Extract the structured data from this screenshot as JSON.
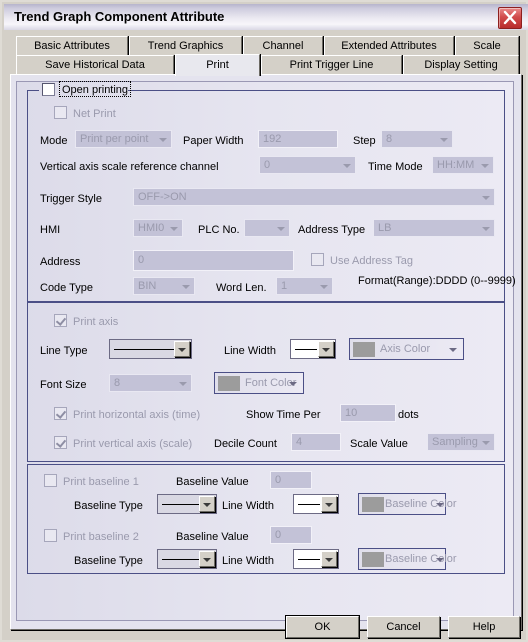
{
  "window": {
    "title": "Trend Graph Component Attribute",
    "close_label": "Close"
  },
  "tabs": {
    "row1": [
      {
        "label": "Basic Attributes",
        "active": false
      },
      {
        "label": "Trend Graphics",
        "active": false
      },
      {
        "label": "Channel",
        "active": false
      },
      {
        "label": "Extended Attributes",
        "active": false
      },
      {
        "label": "Scale",
        "active": false
      }
    ],
    "row2": [
      {
        "label": "Save Historical Data",
        "active": false
      },
      {
        "label": "Print",
        "active": true
      },
      {
        "label": "Print Trigger Line",
        "active": false
      },
      {
        "label": "Display Setting",
        "active": false
      }
    ]
  },
  "print_group": {
    "open_printing_label": "Open printing",
    "open_printing_checked": false,
    "net_print_label": "Net Print",
    "net_print_checked": false,
    "mode_label": "Mode",
    "mode_value": "Print per point",
    "paper_width_label": "Paper Width",
    "paper_width_value": "192",
    "step_label": "Step",
    "step_value": "8",
    "vertical_axis_label": "Vertical axis scale reference channel",
    "vertical_axis_value": "0",
    "time_mode_label": "Time Mode",
    "time_mode_value": "HH:MM",
    "trigger_style_label": "Trigger Style",
    "trigger_style_value": "OFF->ON",
    "hmi_label": "HMI",
    "hmi_value": "HMI0",
    "plc_no_label": "PLC No.",
    "plc_no_value": "",
    "address_type_label": "Address Type",
    "address_type_value": "LB",
    "address_label": "Address",
    "address_value": "0",
    "use_address_tag_label": "Use Address Tag",
    "use_address_tag_checked": false,
    "format_label": "Format(Range):DDDD (0--9999)",
    "code_type_label": "Code Type",
    "code_type_value": "BIN",
    "word_len_label": "Word Len.",
    "word_len_value": "1"
  },
  "axis_group": {
    "print_axis_label": "Print axis",
    "print_axis_checked": true,
    "line_type_label": "Line Type",
    "line_width_label": "Line Width",
    "axis_color_label": "Axis Color",
    "axis_color_swatch": "#9c9c9c",
    "font_size_label": "Font Size",
    "font_size_value": "8",
    "font_color_label": "Font Color",
    "font_color_swatch": "#9c9c9c",
    "print_horizontal_label": "Print horizontal axis (time)",
    "print_horizontal_checked": true,
    "show_time_per_label": "Show Time Per",
    "show_time_per_value": "10",
    "dots_label": "dots",
    "print_vertical_label": "Print vertical axis (scale)",
    "print_vertical_checked": true,
    "decile_count_label": "Decile Count",
    "decile_count_value": "4",
    "scale_value_label": "Scale Value",
    "scale_value_value": "Sampling"
  },
  "baseline_group": {
    "rows": [
      {
        "print_label": "Print baseline 1",
        "print_checked": false,
        "value_label": "Baseline Value",
        "value": "0",
        "type_label": "Baseline Type",
        "width_label": "Line Width",
        "color_label": "Baseline Color",
        "color_swatch": "#9c9c9c"
      },
      {
        "print_label": "Print baseline 2",
        "print_checked": false,
        "value_label": "Baseline Value",
        "value": "0",
        "type_label": "Baseline Type",
        "width_label": "Line Width",
        "color_label": "Baseline Color",
        "color_swatch": "#9c9c9c"
      }
    ]
  },
  "footer": {
    "ok_label": "OK",
    "cancel_label": "Cancel",
    "help_label": "Help"
  }
}
